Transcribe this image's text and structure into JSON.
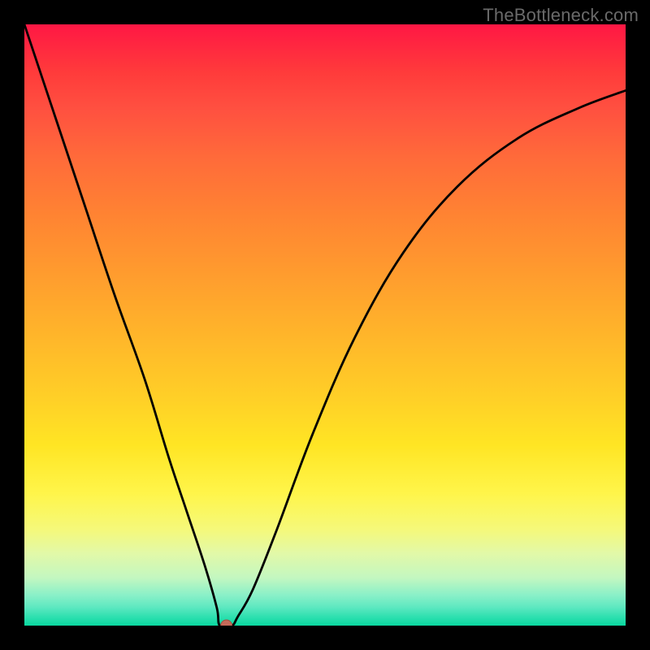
{
  "watermark": {
    "text": "TheBottleneck.com"
  },
  "chart_data": {
    "type": "line",
    "title": "",
    "xlabel": "",
    "ylabel": "",
    "xlim": [
      0,
      100
    ],
    "ylim": [
      0,
      100
    ],
    "grid": false,
    "legend": false,
    "series": [
      {
        "name": "curve",
        "x": [
          0,
          5,
          10,
          15,
          20,
          24,
          27,
          30,
          32,
          32.5,
          34.5,
          35.5,
          38,
          42,
          48,
          55,
          63,
          72,
          82,
          92,
          100
        ],
        "values": [
          100,
          85,
          70,
          55,
          41,
          28,
          19,
          10,
          3,
          0,
          0,
          1.5,
          6,
          16,
          32,
          48,
          62,
          73,
          81,
          86,
          89
        ]
      }
    ],
    "markers": [
      {
        "name": "minimum-point",
        "x": 33.6,
        "y": 0,
        "color": "#c56a5a",
        "radius": 7
      }
    ],
    "background_gradient": {
      "type": "vertical",
      "stops": [
        {
          "pos": 0,
          "color": "#ff1744"
        },
        {
          "pos": 50,
          "color": "#ffd21f"
        },
        {
          "pos": 80,
          "color": "#f5f97a"
        },
        {
          "pos": 100,
          "color": "#0ad8a0"
        }
      ]
    }
  }
}
